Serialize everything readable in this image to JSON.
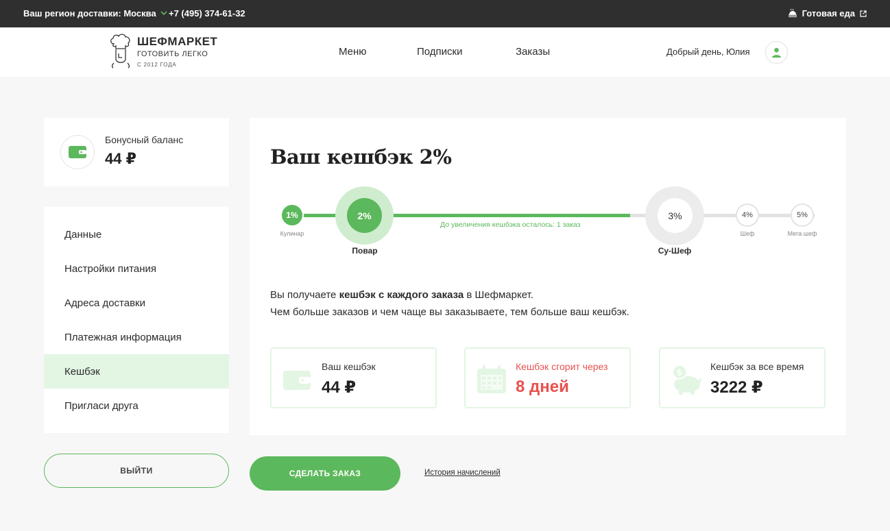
{
  "topbar": {
    "region_label": "Ваш регион доставки: Москва",
    "phone": "+7 (495) 374-61-32",
    "ready_food": "Готовая еда"
  },
  "header": {
    "logo": {
      "brand": "ШЕФМАРКЕТ",
      "tagline": "ГОТОВИТЬ ЛЕГКО",
      "since": "С 2012 ГОДА"
    },
    "nav": [
      "Меню",
      "Подписки",
      "Заказы"
    ],
    "greeting": "Добрый день, Юлия"
  },
  "sidebar": {
    "bonus": {
      "label": "Бонусный баланс",
      "value": "44 ₽"
    },
    "menu": [
      {
        "label": "Данные",
        "active": false
      },
      {
        "label": "Настройки питания",
        "active": false
      },
      {
        "label": "Адреса доставки",
        "active": false
      },
      {
        "label": "Платежная информация",
        "active": false
      },
      {
        "label": "Кешбэк",
        "active": true
      },
      {
        "label": "Пригласи друга",
        "active": false
      }
    ],
    "logout_label": "ВЫЙТИ"
  },
  "main": {
    "title": "Ваш кешбэк 2%",
    "levels": [
      {
        "pct": "1%",
        "name": "Кулинар",
        "status": "done"
      },
      {
        "pct": "2%",
        "name": "Повар",
        "status": "current"
      },
      {
        "pct": "3%",
        "name": "Су-Шеф",
        "status": "next"
      },
      {
        "pct": "4%",
        "name": "Шеф",
        "status": "todo"
      },
      {
        "pct": "5%",
        "name": "Мега шеф",
        "status": "todo"
      }
    ],
    "remaining_text": "До увеличения кешбэка осталось: 1 заказ",
    "desc_line1_pre": "Вы получаете ",
    "desc_line1_bold": "кешбэк с каждого заказа",
    "desc_line1_post": " в Шефмаркет.",
    "desc_line2": "Чем больше заказов и чем чаще вы заказываете, тем больше ваш кешбэк.",
    "stats": [
      {
        "label": "Ваш кешбэк",
        "value": "44 ₽",
        "icon": "wallet-icon"
      },
      {
        "label": "Кешбэк сгорит через",
        "value": "8 дней",
        "icon": "calendar-icon"
      },
      {
        "label": "Кешбэк за все время",
        "value": "3222 ₽",
        "icon": "piggy-bank-icon"
      }
    ]
  },
  "actions": {
    "order_label": "СДЕЛАТЬ ЗАКАЗ",
    "history_label": "История начислений"
  },
  "colors": {
    "accent": "#5cb85c",
    "accent_light": "#e3f5e3",
    "warning": "#e8514f",
    "topbar": "#2f2f2f"
  }
}
